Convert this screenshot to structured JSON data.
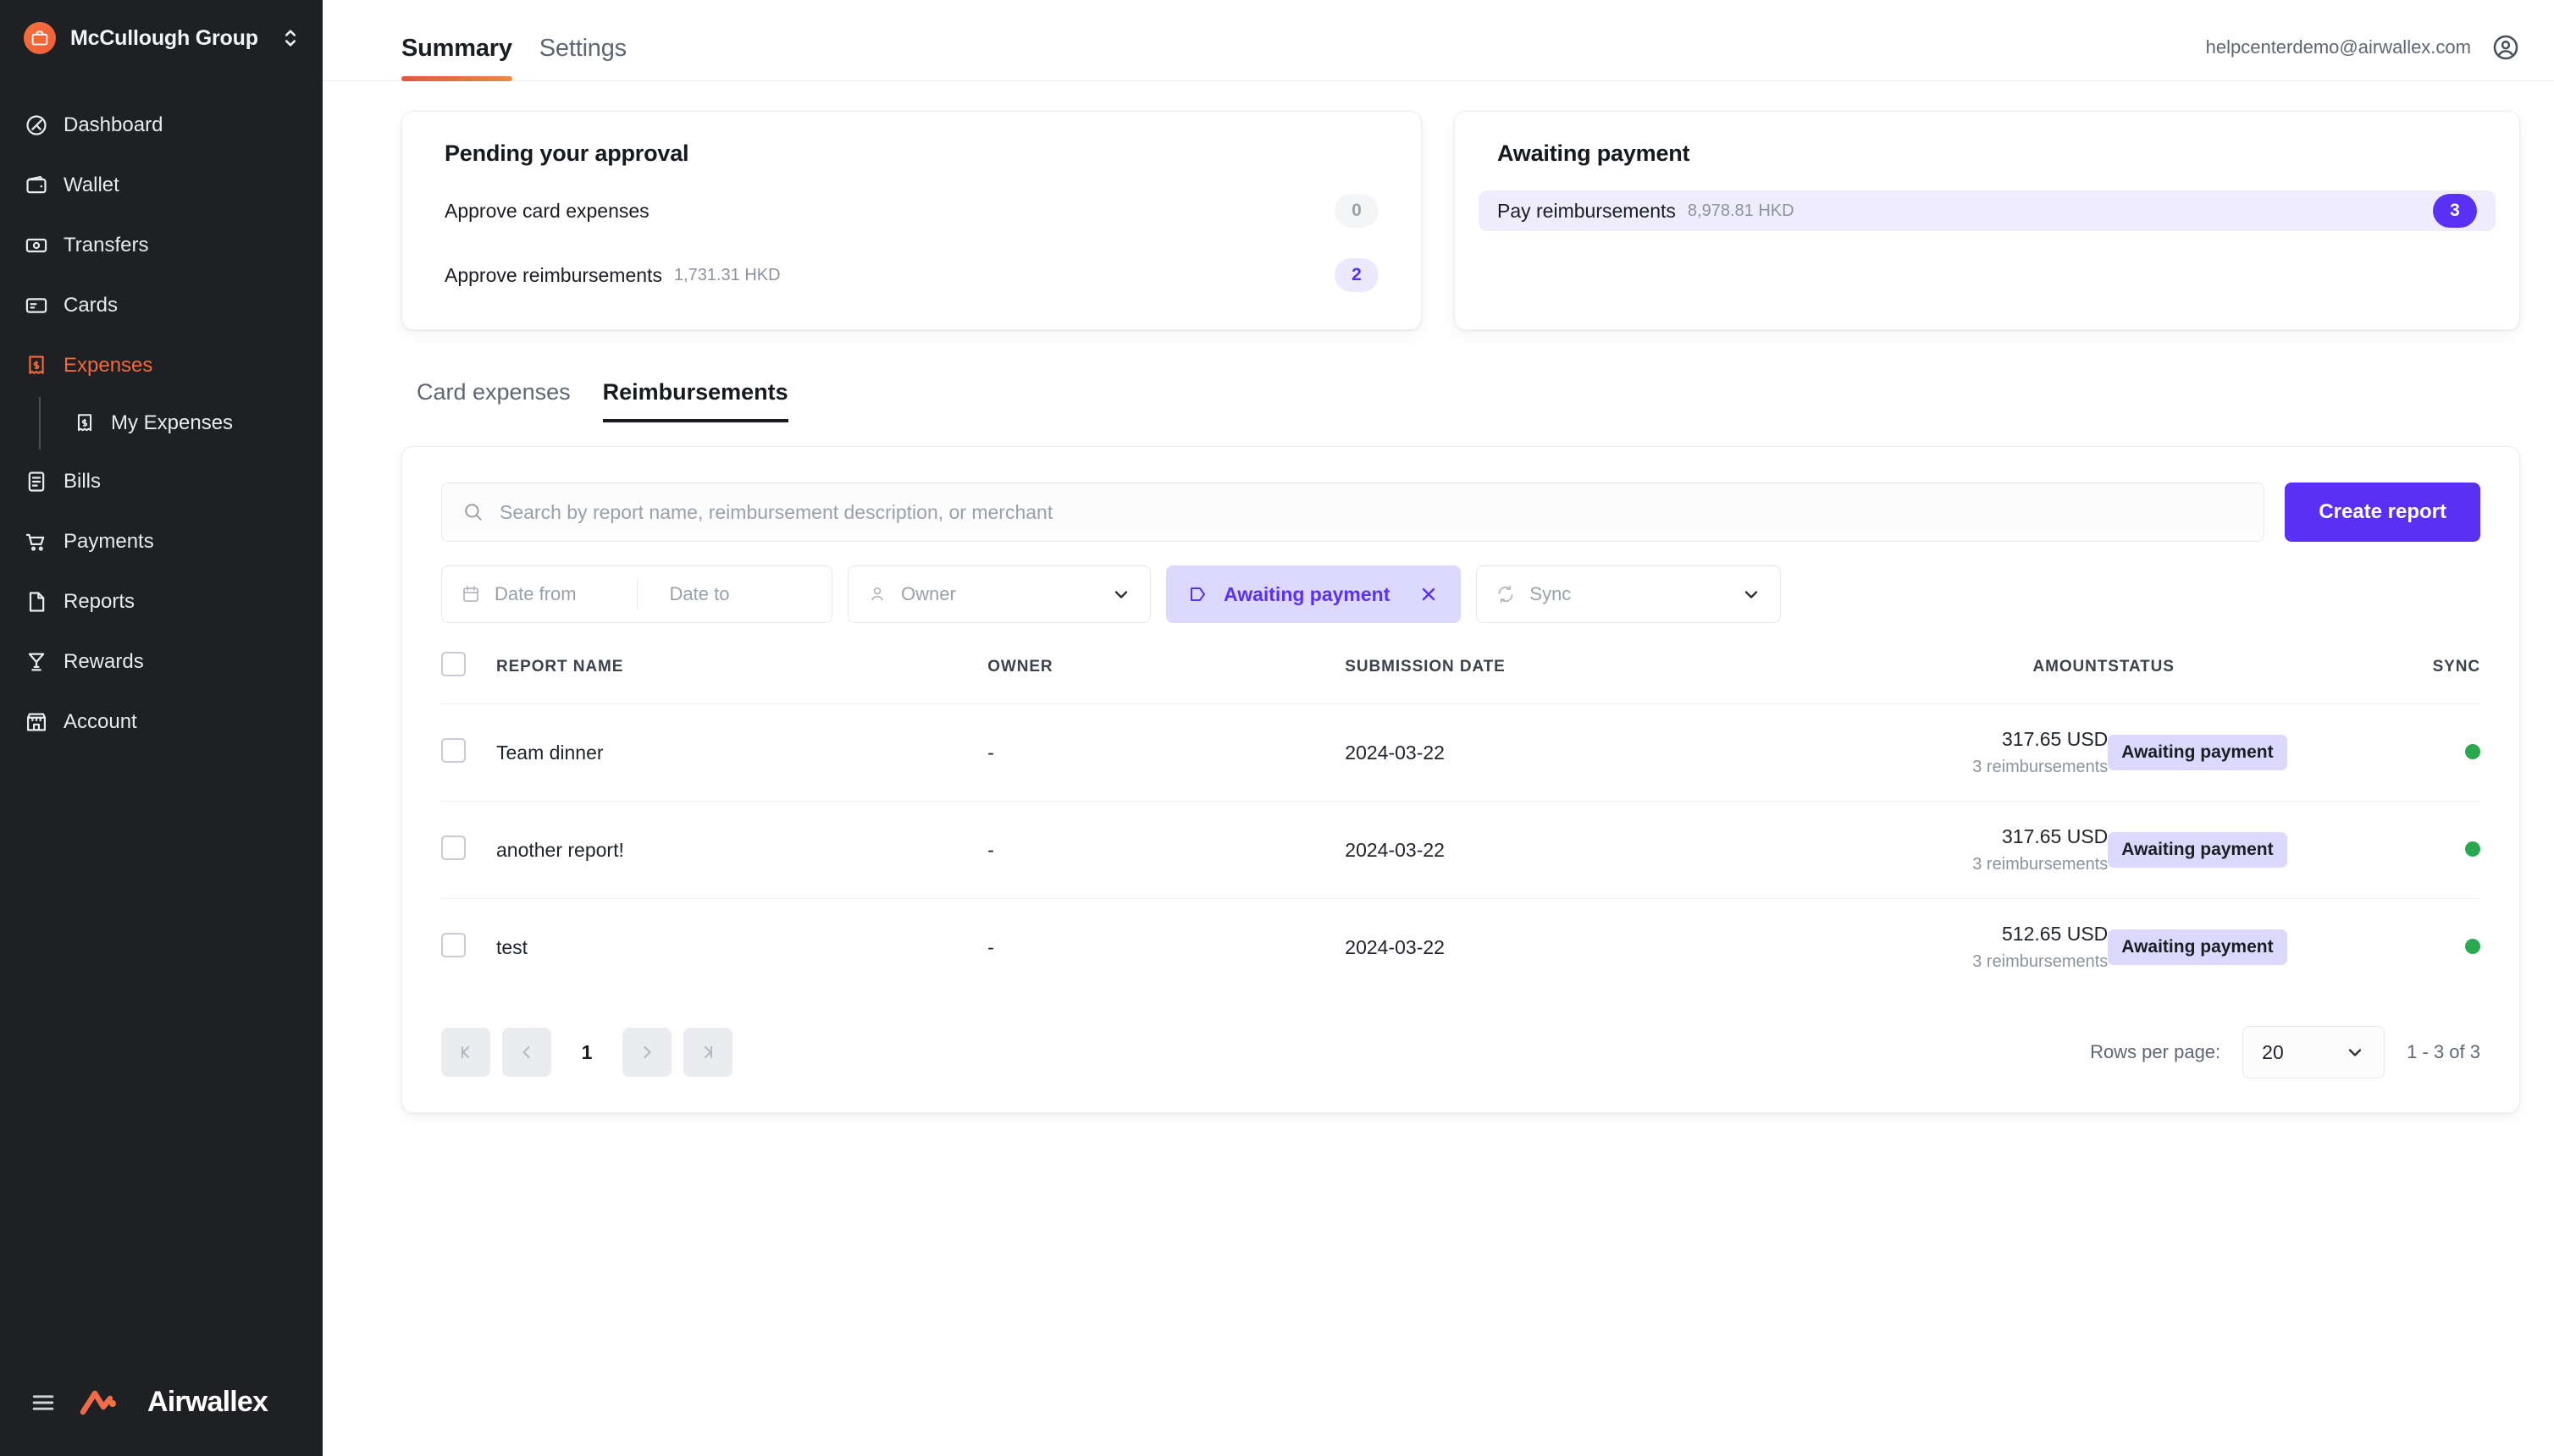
{
  "sidebar": {
    "org": {
      "name": "McCullough Group",
      "avatar_icon": "briefcase-icon",
      "switch_icon": "chevron-updown-icon"
    },
    "items": [
      {
        "label": "Dashboard",
        "icon": "dashboard-icon",
        "active": false
      },
      {
        "label": "Wallet",
        "icon": "wallet-icon",
        "active": false
      },
      {
        "label": "Transfers",
        "icon": "transfers-icon",
        "active": false
      },
      {
        "label": "Cards",
        "icon": "card-icon",
        "active": false
      },
      {
        "label": "Expenses",
        "icon": "receipt-icon",
        "active": true
      },
      {
        "label": "Bills",
        "icon": "bills-icon",
        "active": false
      },
      {
        "label": "Payments",
        "icon": "cart-icon",
        "active": false
      },
      {
        "label": "Reports",
        "icon": "document-icon",
        "active": false
      },
      {
        "label": "Rewards",
        "icon": "trophy-icon",
        "active": false
      },
      {
        "label": "Account",
        "icon": "store-icon",
        "active": false
      }
    ],
    "sub_item": {
      "label": "My Expenses",
      "icon": "receipt-icon"
    },
    "footer": {
      "collapse_icon": "hamburger-icon",
      "brand": "Airwallex",
      "brand_icon": "airwallex-logo-icon"
    }
  },
  "topbar": {
    "tabs": [
      {
        "label": "Summary",
        "active": true
      },
      {
        "label": "Settings",
        "active": false
      }
    ],
    "user_email": "helpcenterdemo@airwallex.com",
    "account_icon": "user-circle-icon"
  },
  "summary": {
    "pending": {
      "title": "Pending your approval",
      "rows": [
        {
          "label": "Approve card expenses",
          "amount": "",
          "count": "0",
          "badge_style": "zero"
        },
        {
          "label": "Approve reimbursements",
          "amount": "1,731.31 HKD",
          "count": "2",
          "badge_style": "count"
        }
      ]
    },
    "awaiting": {
      "title": "Awaiting payment",
      "rows": [
        {
          "label": "Pay reimbursements",
          "amount": "8,978.81 HKD",
          "count": "3",
          "badge_style": "solid"
        }
      ]
    }
  },
  "section_tabs": [
    {
      "label": "Card expenses",
      "active": false
    },
    {
      "label": "Reimbursements",
      "active": true
    }
  ],
  "toolbar": {
    "search_placeholder": "Search by report name, reimbursement description, or merchant",
    "search_value": "",
    "search_icon": "search-icon",
    "create_report_label": "Create report",
    "filters": {
      "date_from_placeholder": "Date from",
      "date_to_placeholder": "Date to",
      "calendar_icon": "calendar-icon",
      "owner_label": "Owner",
      "owner_icon": "person-icon",
      "chevron_icon": "chevron-down-icon",
      "status_chip_label": "Awaiting payment",
      "status_chip_icon": "tag-icon",
      "status_chip_clear_icon": "close-icon",
      "sync_label": "Sync",
      "sync_icon": "sync-icon"
    }
  },
  "table": {
    "select_all_icon": "checkbox-icon",
    "columns": [
      "REPORT NAME",
      "OWNER",
      "SUBMISSION DATE",
      "AMOUNT",
      "STATUS",
      "SYNC"
    ],
    "rows": [
      {
        "report_name": "Team dinner",
        "owner": "-",
        "submission_date": "2024-03-22",
        "amount": "317.65 USD",
        "amount_sub": "3 reimbursements",
        "status": "Awaiting payment",
        "sync_state": "synced"
      },
      {
        "report_name": "another report!",
        "owner": "-",
        "submission_date": "2024-03-22",
        "amount": "317.65 USD",
        "amount_sub": "3 reimbursements",
        "status": "Awaiting payment",
        "sync_state": "synced"
      },
      {
        "report_name": "test",
        "owner": "-",
        "submission_date": "2024-03-22",
        "amount": "512.65 USD",
        "amount_sub": "3 reimbursements",
        "status": "Awaiting payment",
        "sync_state": "synced"
      }
    ]
  },
  "pagination": {
    "first_icon": "first-page-icon",
    "prev_icon": "prev-page-icon",
    "next_icon": "next-page-icon",
    "last_icon": "last-page-icon",
    "current_page": "1",
    "rows_per_page_label": "Rows per page:",
    "rows_per_page_value": "20",
    "rows_per_page_chevron": "chevron-down-icon",
    "range_label": "1 - 3 of 3"
  },
  "colors": {
    "brand_orange": "#f06a3c",
    "accent_purple": "#5a31f4",
    "chip_purple_bg": "#ddd8fd",
    "sidebar_bg": "#1e2023",
    "sync_green": "#2aa84f"
  }
}
